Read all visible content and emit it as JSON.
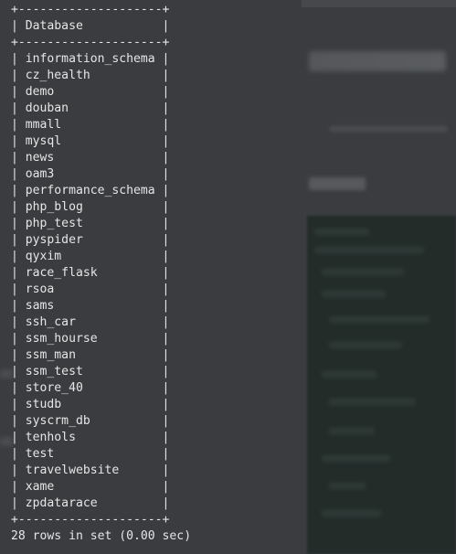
{
  "terminal": {
    "border": "+--------------------+",
    "header": "| Database           |",
    "rows": [
      "| information_schema |",
      "| cz_health          |",
      "| demo               |",
      "| douban             |",
      "| mmall              |",
      "| mysql              |",
      "| news               |",
      "| oam3               |",
      "| performance_schema |",
      "| php_blog           |",
      "| php_test           |",
      "| pyspider           |",
      "| qyxim              |",
      "| race_flask         |",
      "| rsoa               |",
      "| sams               |",
      "| ssh_car            |",
      "| ssm_hourse         |",
      "| ssm_man            |",
      "| ssm_test           |",
      "| store_40           |",
      "| studb              |",
      "| syscrm_db          |",
      "| tenhols            |",
      "| test               |",
      "| travelwebsite      |",
      "| xame               |",
      "| zpdatarace         |"
    ],
    "summary": "28 rows in set (0.00 sec)"
  },
  "colors": {
    "text": "#e6e6e6",
    "background": "#3e4043",
    "code_block": "#242c2a"
  }
}
